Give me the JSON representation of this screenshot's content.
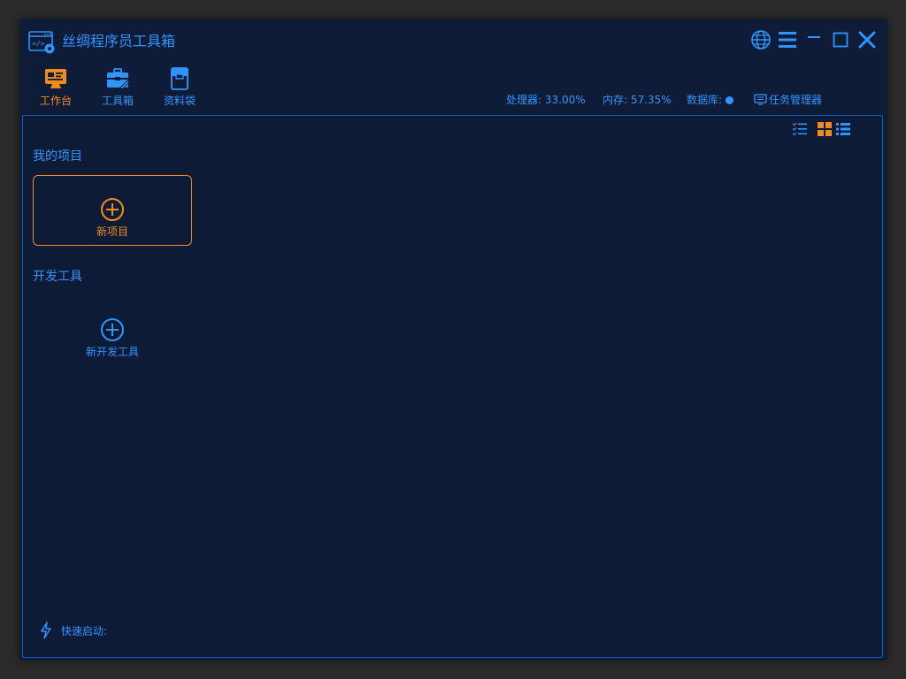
{
  "app": {
    "title": "丝绸程序员工具箱",
    "logo_icon": "code-window-gear-icon"
  },
  "window_controls": [
    {
      "name": "language",
      "icon": "globe-icon"
    },
    {
      "name": "menu",
      "icon": "hamburger-menu-icon"
    },
    {
      "name": "minimize",
      "icon": "minimize-icon"
    },
    {
      "name": "maximize",
      "icon": "maximize-icon"
    },
    {
      "name": "close",
      "icon": "close-icon"
    }
  ],
  "nav": {
    "tabs": [
      {
        "label": "工作台",
        "icon": "workbench-monitor-icon",
        "active": true
      },
      {
        "label": "工具箱",
        "icon": "toolbox-icon",
        "active": false
      },
      {
        "label": "资料袋",
        "icon": "document-bag-icon",
        "active": false
      }
    ]
  },
  "status": {
    "cpu": "处理器: 33.00%",
    "memory": "内存: 57.35%",
    "database": "数据库:",
    "task_manager": "任务管理器"
  },
  "view_toggles": [
    {
      "name": "checklist",
      "icon": "checklist-icon"
    },
    {
      "name": "grid",
      "icon": "grid-view-icon",
      "active": true
    },
    {
      "name": "list",
      "icon": "list-view-icon"
    }
  ],
  "sections": {
    "projects": {
      "title": "我的项目",
      "new_label": "新项目"
    },
    "tools": {
      "title": "开发工具",
      "new_label": "新开发工具"
    }
  },
  "quick_launch": {
    "label": "快速启动:",
    "icon": "lightning-icon"
  },
  "colors": {
    "accent": "#2f96ff",
    "active": "#f08c1e",
    "background": "#0e1c38",
    "border": "#1560b0"
  }
}
